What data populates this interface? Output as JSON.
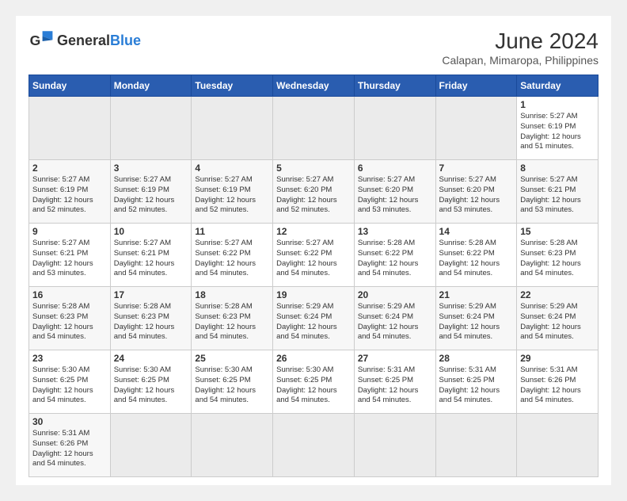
{
  "header": {
    "logo_general": "General",
    "logo_blue": "Blue",
    "month_year": "June 2024",
    "location": "Calapan, Mimaropa, Philippines"
  },
  "days_of_week": [
    "Sunday",
    "Monday",
    "Tuesday",
    "Wednesday",
    "Thursday",
    "Friday",
    "Saturday"
  ],
  "weeks": [
    {
      "cells": [
        {
          "day": "",
          "info": "",
          "empty": true
        },
        {
          "day": "",
          "info": "",
          "empty": true
        },
        {
          "day": "",
          "info": "",
          "empty": true
        },
        {
          "day": "",
          "info": "",
          "empty": true
        },
        {
          "day": "",
          "info": "",
          "empty": true
        },
        {
          "day": "",
          "info": "",
          "empty": true
        },
        {
          "day": "1",
          "info": "Sunrise: 5:27 AM\nSunset: 6:19 PM\nDaylight: 12 hours\nand 51 minutes."
        }
      ]
    },
    {
      "cells": [
        {
          "day": "2",
          "info": "Sunrise: 5:27 AM\nSunset: 6:19 PM\nDaylight: 12 hours\nand 52 minutes."
        },
        {
          "day": "3",
          "info": "Sunrise: 5:27 AM\nSunset: 6:19 PM\nDaylight: 12 hours\nand 52 minutes."
        },
        {
          "day": "4",
          "info": "Sunrise: 5:27 AM\nSunset: 6:19 PM\nDaylight: 12 hours\nand 52 minutes."
        },
        {
          "day": "5",
          "info": "Sunrise: 5:27 AM\nSunset: 6:20 PM\nDaylight: 12 hours\nand 52 minutes."
        },
        {
          "day": "6",
          "info": "Sunrise: 5:27 AM\nSunset: 6:20 PM\nDaylight: 12 hours\nand 53 minutes."
        },
        {
          "day": "7",
          "info": "Sunrise: 5:27 AM\nSunset: 6:20 PM\nDaylight: 12 hours\nand 53 minutes."
        },
        {
          "day": "8",
          "info": "Sunrise: 5:27 AM\nSunset: 6:21 PM\nDaylight: 12 hours\nand 53 minutes."
        }
      ]
    },
    {
      "cells": [
        {
          "day": "9",
          "info": "Sunrise: 5:27 AM\nSunset: 6:21 PM\nDaylight: 12 hours\nand 53 minutes."
        },
        {
          "day": "10",
          "info": "Sunrise: 5:27 AM\nSunset: 6:21 PM\nDaylight: 12 hours\nand 54 minutes."
        },
        {
          "day": "11",
          "info": "Sunrise: 5:27 AM\nSunset: 6:22 PM\nDaylight: 12 hours\nand 54 minutes."
        },
        {
          "day": "12",
          "info": "Sunrise: 5:27 AM\nSunset: 6:22 PM\nDaylight: 12 hours\nand 54 minutes."
        },
        {
          "day": "13",
          "info": "Sunrise: 5:28 AM\nSunset: 6:22 PM\nDaylight: 12 hours\nand 54 minutes."
        },
        {
          "day": "14",
          "info": "Sunrise: 5:28 AM\nSunset: 6:22 PM\nDaylight: 12 hours\nand 54 minutes."
        },
        {
          "day": "15",
          "info": "Sunrise: 5:28 AM\nSunset: 6:23 PM\nDaylight: 12 hours\nand 54 minutes."
        }
      ]
    },
    {
      "cells": [
        {
          "day": "16",
          "info": "Sunrise: 5:28 AM\nSunset: 6:23 PM\nDaylight: 12 hours\nand 54 minutes."
        },
        {
          "day": "17",
          "info": "Sunrise: 5:28 AM\nSunset: 6:23 PM\nDaylight: 12 hours\nand 54 minutes."
        },
        {
          "day": "18",
          "info": "Sunrise: 5:28 AM\nSunset: 6:23 PM\nDaylight: 12 hours\nand 54 minutes."
        },
        {
          "day": "19",
          "info": "Sunrise: 5:29 AM\nSunset: 6:24 PM\nDaylight: 12 hours\nand 54 minutes."
        },
        {
          "day": "20",
          "info": "Sunrise: 5:29 AM\nSunset: 6:24 PM\nDaylight: 12 hours\nand 54 minutes."
        },
        {
          "day": "21",
          "info": "Sunrise: 5:29 AM\nSunset: 6:24 PM\nDaylight: 12 hours\nand 54 minutes."
        },
        {
          "day": "22",
          "info": "Sunrise: 5:29 AM\nSunset: 6:24 PM\nDaylight: 12 hours\nand 54 minutes."
        }
      ]
    },
    {
      "cells": [
        {
          "day": "23",
          "info": "Sunrise: 5:30 AM\nSunset: 6:25 PM\nDaylight: 12 hours\nand 54 minutes."
        },
        {
          "day": "24",
          "info": "Sunrise: 5:30 AM\nSunset: 6:25 PM\nDaylight: 12 hours\nand 54 minutes."
        },
        {
          "day": "25",
          "info": "Sunrise: 5:30 AM\nSunset: 6:25 PM\nDaylight: 12 hours\nand 54 minutes."
        },
        {
          "day": "26",
          "info": "Sunrise: 5:30 AM\nSunset: 6:25 PM\nDaylight: 12 hours\nand 54 minutes."
        },
        {
          "day": "27",
          "info": "Sunrise: 5:31 AM\nSunset: 6:25 PM\nDaylight: 12 hours\nand 54 minutes."
        },
        {
          "day": "28",
          "info": "Sunrise: 5:31 AM\nSunset: 6:25 PM\nDaylight: 12 hours\nand 54 minutes."
        },
        {
          "day": "29",
          "info": "Sunrise: 5:31 AM\nSunset: 6:26 PM\nDaylight: 12 hours\nand 54 minutes."
        }
      ]
    },
    {
      "cells": [
        {
          "day": "30",
          "info": "Sunrise: 5:31 AM\nSunset: 6:26 PM\nDaylight: 12 hours\nand 54 minutes."
        },
        {
          "day": "",
          "info": "",
          "empty": true
        },
        {
          "day": "",
          "info": "",
          "empty": true
        },
        {
          "day": "",
          "info": "",
          "empty": true
        },
        {
          "day": "",
          "info": "",
          "empty": true
        },
        {
          "day": "",
          "info": "",
          "empty": true
        },
        {
          "day": "",
          "info": "",
          "empty": true
        }
      ]
    }
  ]
}
